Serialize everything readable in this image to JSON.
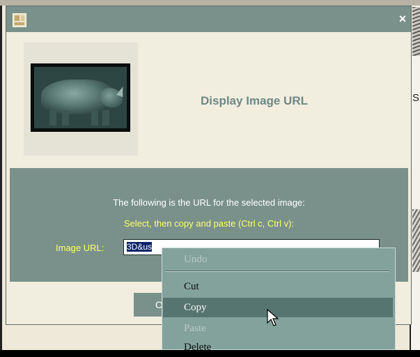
{
  "dialog": {
    "title": "",
    "close_glyph": "×",
    "heading": "Display Image URL",
    "thumbnail_alt": "Rhinoceros engraving thumbnail",
    "info_text": "The following is the URL for the selected image:",
    "instruction_text": "Select, then copy and paste (Ctrl c, Ctrl v):",
    "url_label": "Image URL:",
    "url_value_selected": "3D&us",
    "url_value_rest": "",
    "ok_label": "O"
  },
  "context_menu": {
    "items": [
      {
        "label": "Undo",
        "state": "disabled"
      },
      {
        "label": "Cut",
        "state": "normal"
      },
      {
        "label": "Copy",
        "state": "hover"
      },
      {
        "label": "Paste",
        "state": "disabled"
      },
      {
        "label": "Delete",
        "state": "normal"
      }
    ]
  },
  "background": {
    "partial_letter": "S"
  },
  "colors": {
    "titlebar": "#7a918b",
    "dialog_bg": "#f1eddf",
    "panel_bg": "#7a918b",
    "accent_yellow": "#ffff66",
    "heading_color": "#6f8884",
    "menu_bg": "#83a29c",
    "menu_active": "#567570"
  },
  "icons": [
    "window-app-icon",
    "close-icon",
    "arrow-cursor-icon"
  ]
}
